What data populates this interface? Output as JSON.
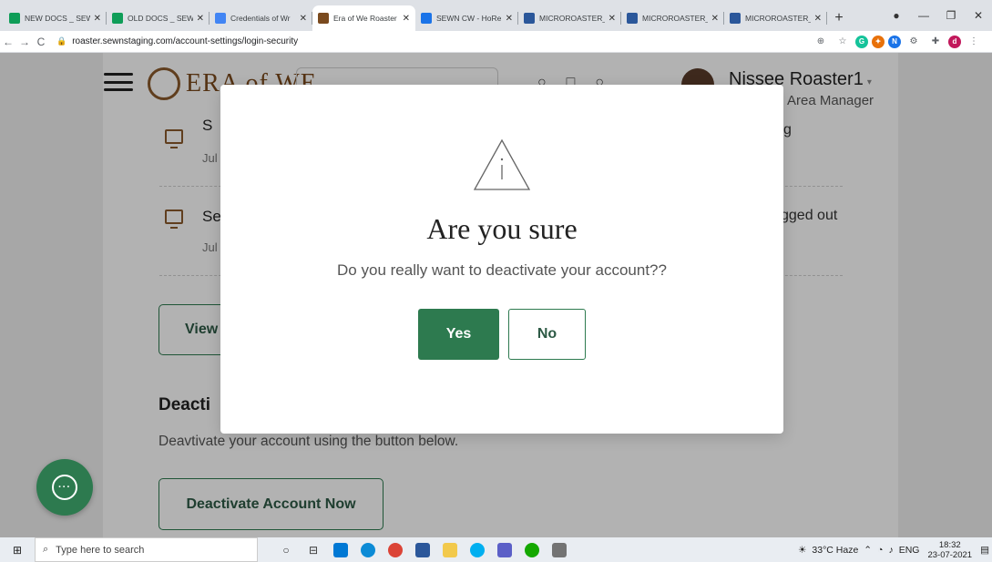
{
  "browser": {
    "tabs": [
      {
        "title": "NEW DOCS _ SEW",
        "favicon_color": "#0f9d58",
        "active": false
      },
      {
        "title": "OLD DOCS _ SEW",
        "favicon_color": "#0f9d58",
        "active": false
      },
      {
        "title": "Credentials of Wr",
        "favicon_color": "#4285f4",
        "active": false
      },
      {
        "title": "Era of We Roaster",
        "favicon_color": "#7a4a1e",
        "active": true
      },
      {
        "title": "SEWN CW - HoRe",
        "favicon_color": "#1a73e8",
        "active": false
      },
      {
        "title": "MICROROASTER_",
        "favicon_color": "#2b579a",
        "active": false
      },
      {
        "title": "MICROROASTER_",
        "favicon_color": "#2b579a",
        "active": false
      },
      {
        "title": "MICROROASTER_",
        "favicon_color": "#2b579a",
        "active": false
      }
    ],
    "url": "roaster.sewnstaging.com/account-settings/login-security",
    "profile_initial": "d"
  },
  "header": {
    "logo_text": "ERA of WE",
    "user_name": "Nissee Roaster1",
    "user_role": "Area Manager"
  },
  "sessions": [
    {
      "title": "S",
      "date": "Jul",
      "status": "g"
    },
    {
      "title": "Se",
      "date": "Jul",
      "status": "gged out"
    }
  ],
  "view_button_label": "View",
  "deactivate": {
    "title": "Deacti",
    "description": "Deavtivate your account using the button below.",
    "button_label": "Deactivate Account Now"
  },
  "modal": {
    "title": "Are you sure",
    "message": "Do you really want to deactivate your account??",
    "yes_label": "Yes",
    "no_label": "No"
  },
  "taskbar": {
    "search_placeholder": "Type here to search",
    "weather": "33°C Haze",
    "lang": "ENG",
    "time": "18:32",
    "date": "23-07-2021"
  }
}
